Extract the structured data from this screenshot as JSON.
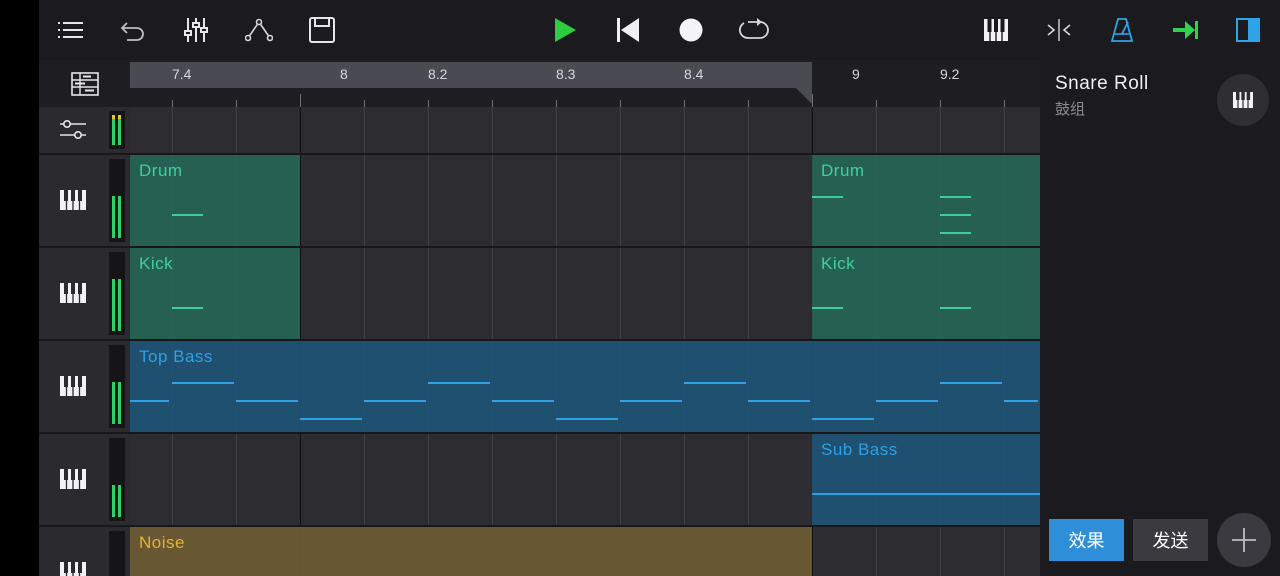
{
  "toolbar": {
    "left_icons": [
      "menu-icon",
      "undo-icon",
      "mixer-icon",
      "automation-icon",
      "save-icon"
    ],
    "center_icons": [
      "play-icon",
      "rewind-to-start-icon",
      "record-icon",
      "loop-icon"
    ],
    "right_icons": [
      "piano-roll-icon",
      "split-icon",
      "metronome-icon",
      "follow-icon",
      "panel-toggle-icon"
    ],
    "accent_play": "#2ecc40",
    "accent_blue": "#2fa3e6",
    "accent_green": "#32d24d"
  },
  "ruler": {
    "labels": [
      "7.4",
      "8",
      "8.2",
      "8.3",
      "8.4",
      "9",
      "9.2"
    ]
  },
  "tracks": [
    {
      "icon": "master-routing-icon"
    },
    {
      "icon": "piano-keys-icon"
    },
    {
      "icon": "piano-keys-icon"
    },
    {
      "icon": "piano-keys-icon"
    },
    {
      "icon": "piano-keys-icon"
    },
    {
      "icon": "piano-keys-icon"
    }
  ],
  "clips": {
    "drum_a": "Drum",
    "drum_b": "Drum",
    "kick_a": "Kick",
    "kick_b": "Kick",
    "top_bass": "Top  Bass",
    "sub_bass": "Sub  Bass",
    "noise": "Noise"
  },
  "colors": {
    "drum": "#256b5a",
    "drum_text": "#3fcf9e",
    "bass": "#1f5477",
    "bass_text": "#2ea0e6",
    "noise": "#6b5a34",
    "noise_text": "#e8b233"
  },
  "side": {
    "instrument_name": "Snare  Roll",
    "instrument_group": "鼓组",
    "effects_label": "效果",
    "send_label": "发送",
    "add_icon": "plus-icon",
    "instrument_icon": "piano-keys-icon"
  }
}
